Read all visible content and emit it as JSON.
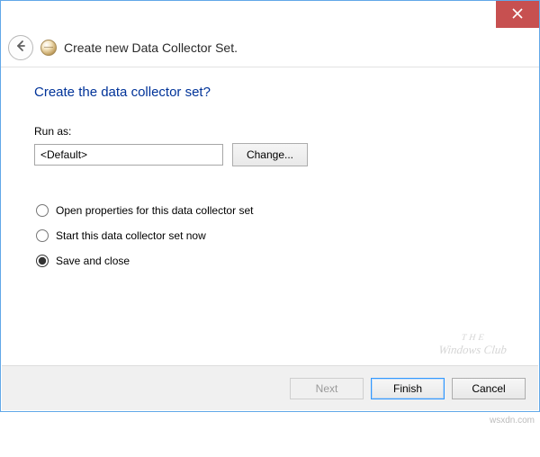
{
  "window": {
    "title": "Create new Data Collector Set."
  },
  "page": {
    "heading": "Create the data collector set?",
    "runas_label": "Run as:",
    "runas_value": "<Default>",
    "change_button": "Change..."
  },
  "options": {
    "open_properties": "Open properties for this data collector set",
    "start_now": "Start this data collector set now",
    "save_close": "Save and close",
    "selected": "save_close"
  },
  "footer": {
    "next": "Next",
    "finish": "Finish",
    "cancel": "Cancel"
  },
  "watermark": {
    "line1": "THE",
    "line2": "Windows Club"
  },
  "attribution": "wsxdn.com"
}
